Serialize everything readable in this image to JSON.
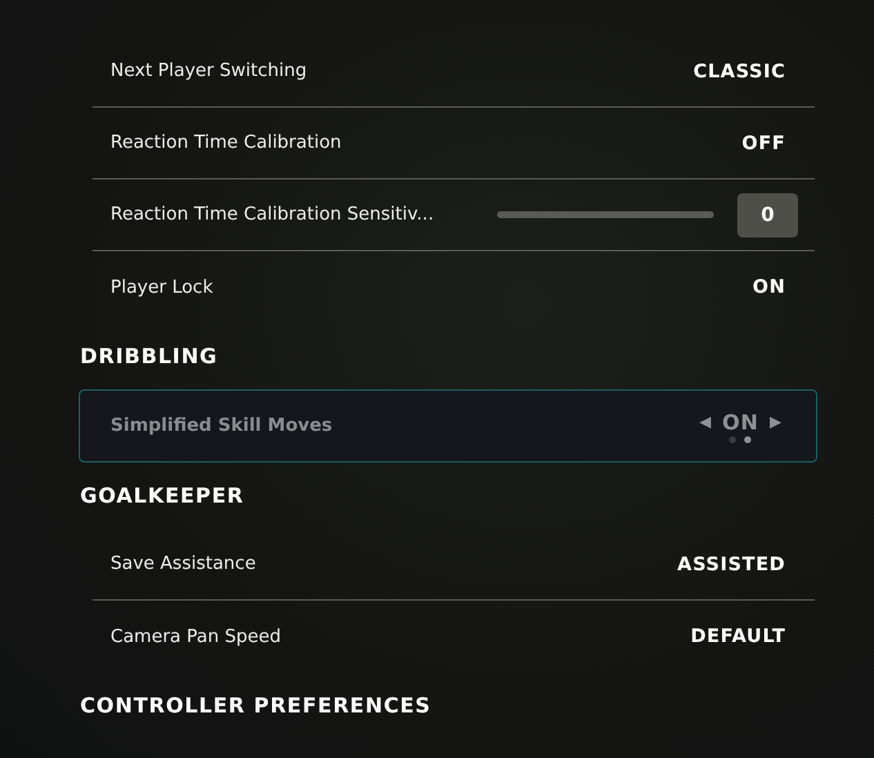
{
  "sections": [
    {
      "rows": [
        {
          "kind": "option",
          "label": "Next Player Switching",
          "value": "CLASSIC"
        },
        {
          "kind": "option",
          "label": "Reaction Time Calibration",
          "value": "OFF"
        },
        {
          "kind": "slider",
          "label": "Reaction Time Calibration Sensitiv...",
          "level": 0,
          "value": "0"
        },
        {
          "kind": "option",
          "label": "Player Lock",
          "value": "ON"
        }
      ]
    },
    {
      "title": "DRIBBLING",
      "rows": [
        {
          "kind": "carousel",
          "label": "Simplified Skill Moves",
          "value": "ON",
          "left_arrow": "◀",
          "right_arrow": "▶",
          "focused": true,
          "pages": [
            {
              "selected": false
            },
            {
              "selected": true
            }
          ]
        }
      ]
    },
    {
      "title": "GOALKEEPER",
      "rows": [
        {
          "kind": "option",
          "label": "Save Assistance",
          "value": "ASSISTED"
        },
        {
          "kind": "option",
          "label": "Camera Pan Speed",
          "value": "DEFAULT"
        }
      ]
    },
    {
      "title": "CONTROLLER PREFERENCES"
    }
  ]
}
